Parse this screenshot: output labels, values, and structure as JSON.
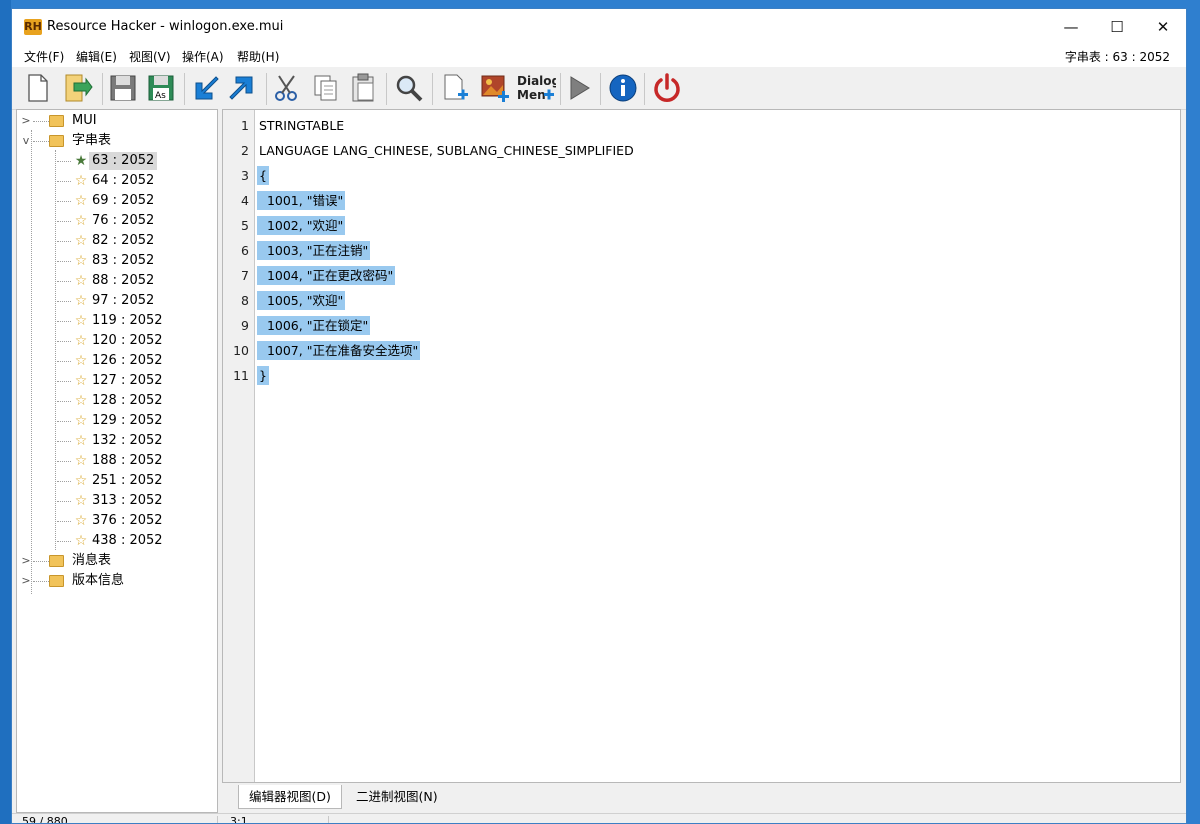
{
  "window": {
    "title": "Resource Hacker - winlogon.exe.mui",
    "logo_text": "RH",
    "minimize_glyph": "—",
    "maximize_glyph": "☐",
    "close_glyph": "✕"
  },
  "menu": {
    "items": [
      "文件(F)",
      "编辑(E)",
      "视图(V)",
      "操作(A)",
      "帮助(H)"
    ],
    "status": "字串表 : 63 : 2052"
  },
  "toolbar": {
    "items": [
      {
        "icon": "new-file-icon"
      },
      {
        "icon": "open-file-icon"
      },
      {
        "icon": "save-icon"
      },
      {
        "icon": "save-as-icon",
        "label": "As"
      },
      {
        "icon": "import-arrow-icon"
      },
      {
        "icon": "export-arrow-icon"
      },
      {
        "icon": "cut-icon"
      },
      {
        "icon": "copy-icon"
      },
      {
        "icon": "paste-icon"
      },
      {
        "icon": "search-icon"
      },
      {
        "icon": "add-resource-icon"
      },
      {
        "icon": "add-image-icon"
      },
      {
        "icon": "dialog-menu-icon",
        "label_top": "Dialog",
        "label_bottom": "Men"
      },
      {
        "icon": "run-script-icon"
      },
      {
        "icon": "info-icon"
      },
      {
        "icon": "power-icon"
      }
    ],
    "colors": {
      "blue_arrow": "#1a7fd6",
      "info": "#1565c0",
      "power": "#c62828"
    }
  },
  "tree": {
    "nodes": [
      {
        "label": "MUI",
        "expanded": false
      },
      {
        "label": "字串表",
        "expanded": true
      },
      {
        "label": "消息表",
        "expanded": false
      },
      {
        "label": "版本信息",
        "expanded": false
      }
    ],
    "children": [
      "63 : 2052",
      "64 : 2052",
      "69 : 2052",
      "76 : 2052",
      "82 : 2052",
      "83 : 2052",
      "88 : 2052",
      "97 : 2052",
      "119 : 2052",
      "120 : 2052",
      "126 : 2052",
      "127 : 2052",
      "128 : 2052",
      "129 : 2052",
      "132 : 2052",
      "188 : 2052",
      "251 : 2052",
      "313 : 2052",
      "376 : 2052",
      "438 : 2052"
    ],
    "selected": "63 : 2052"
  },
  "editor": {
    "lines": [
      {
        "no": "1",
        "text": "STRINGTABLE",
        "highlighted": false
      },
      {
        "no": "2",
        "text": "LANGUAGE LANG_CHINESE, SUBLANG_CHINESE_SIMPLIFIED",
        "highlighted": false
      },
      {
        "no": "3",
        "text": "{",
        "highlighted": true
      },
      {
        "no": "4",
        "text": "  1001, \"错误\"",
        "highlighted": true
      },
      {
        "no": "5",
        "text": "  1002, \"欢迎\"",
        "highlighted": true
      },
      {
        "no": "6",
        "text": "  1003, \"正在注销\"",
        "highlighted": true
      },
      {
        "no": "7",
        "text": "  1004, \"正在更改密码\"",
        "highlighted": true
      },
      {
        "no": "8",
        "text": "  1005, \"欢迎\"",
        "highlighted": true
      },
      {
        "no": "9",
        "text": "  1006, \"正在锁定\"",
        "highlighted": true
      },
      {
        "no": "10",
        "text": "  1007, \"正在准备安全选项\"",
        "highlighted": true
      },
      {
        "no": "11",
        "text": "}",
        "highlighted": true
      }
    ],
    "highlight_color": "#99c9ef"
  },
  "tabs": [
    {
      "label": "编辑器视图(D)",
      "active": true
    },
    {
      "label": "二进制视图(N)",
      "active": false
    }
  ],
  "statusbar": {
    "left": "59 / 880",
    "middle": "3:1"
  }
}
